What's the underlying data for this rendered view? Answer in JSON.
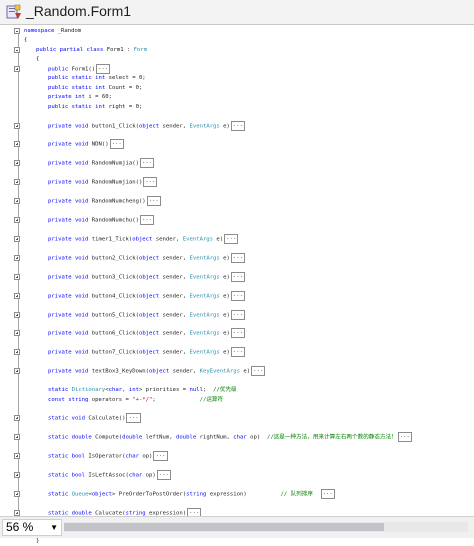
{
  "window": {
    "title": "_Random.Form1",
    "icon": "csharp-file-icon"
  },
  "code_lines": [
    {
      "indent": 0,
      "fold": "minus",
      "parts": [
        {
          "k": "kw",
          "t": "namespace"
        },
        {
          "k": "n",
          "t": " _Random"
        }
      ]
    },
    {
      "indent": 0,
      "fold": "",
      "parts": [
        {
          "k": "n",
          "t": "{"
        }
      ]
    },
    {
      "indent": 1,
      "fold": "minus",
      "parts": [
        {
          "k": "kw",
          "t": "public partial class"
        },
        {
          "k": "n",
          "t": " Form1 : "
        },
        {
          "k": "ty",
          "t": "Form"
        }
      ]
    },
    {
      "indent": 1,
      "fold": "",
      "parts": [
        {
          "k": "n",
          "t": "{"
        }
      ]
    },
    {
      "indent": 2,
      "fold": "plus",
      "parts": [
        {
          "k": "kw",
          "t": "public"
        },
        {
          "k": "n",
          "t": " Form1()"
        }
      ],
      "collapsed": "..."
    },
    {
      "indent": 2,
      "fold": "",
      "parts": [
        {
          "k": "kw",
          "t": "public static int"
        },
        {
          "k": "n",
          "t": " select = 0;"
        }
      ]
    },
    {
      "indent": 2,
      "fold": "",
      "parts": [
        {
          "k": "kw",
          "t": "public static int"
        },
        {
          "k": "n",
          "t": " Count = 0;"
        }
      ]
    },
    {
      "indent": 2,
      "fold": "",
      "parts": [
        {
          "k": "kw",
          "t": "private int"
        },
        {
          "k": "n",
          "t": " i = 60;"
        }
      ]
    },
    {
      "indent": 2,
      "fold": "",
      "parts": [
        {
          "k": "kw",
          "t": "public static int"
        },
        {
          "k": "n",
          "t": " right = 0;"
        }
      ]
    },
    {
      "indent": 0,
      "fold": "",
      "parts": []
    },
    {
      "indent": 2,
      "fold": "plus",
      "parts": [
        {
          "k": "kw",
          "t": "private void"
        },
        {
          "k": "n",
          "t": " button1_Click("
        },
        {
          "k": "kw",
          "t": "object"
        },
        {
          "k": "n",
          "t": " sender, "
        },
        {
          "k": "ty",
          "t": "EventArgs"
        },
        {
          "k": "n",
          "t": " e)"
        }
      ],
      "collapsed": "..."
    },
    {
      "indent": 0,
      "fold": "",
      "parts": []
    },
    {
      "indent": 2,
      "fold": "plus",
      "parts": [
        {
          "k": "kw",
          "t": "private void"
        },
        {
          "k": "n",
          "t": " NDN()"
        }
      ],
      "collapsed": "..."
    },
    {
      "indent": 0,
      "fold": "",
      "parts": []
    },
    {
      "indent": 2,
      "fold": "plus",
      "parts": [
        {
          "k": "kw",
          "t": "private void"
        },
        {
          "k": "n",
          "t": " RandomNumjia()"
        }
      ],
      "collapsed": "..."
    },
    {
      "indent": 0,
      "fold": "",
      "parts": []
    },
    {
      "indent": 2,
      "fold": "plus",
      "parts": [
        {
          "k": "kw",
          "t": "private void"
        },
        {
          "k": "n",
          "t": " RandomNumjian()"
        }
      ],
      "collapsed": "..."
    },
    {
      "indent": 0,
      "fold": "",
      "parts": []
    },
    {
      "indent": 2,
      "fold": "plus",
      "parts": [
        {
          "k": "kw",
          "t": "private void"
        },
        {
          "k": "n",
          "t": " RandomNumcheng()"
        }
      ],
      "collapsed": "..."
    },
    {
      "indent": 0,
      "fold": "",
      "parts": []
    },
    {
      "indent": 2,
      "fold": "plus",
      "parts": [
        {
          "k": "kw",
          "t": "private void"
        },
        {
          "k": "n",
          "t": " RandomNumchu()"
        }
      ],
      "collapsed": "..."
    },
    {
      "indent": 0,
      "fold": "",
      "parts": []
    },
    {
      "indent": 2,
      "fold": "plus",
      "parts": [
        {
          "k": "kw",
          "t": "private void"
        },
        {
          "k": "n",
          "t": " timer1_Tick("
        },
        {
          "k": "kw",
          "t": "object"
        },
        {
          "k": "n",
          "t": " sender, "
        },
        {
          "k": "ty",
          "t": "EventArgs"
        },
        {
          "k": "n",
          "t": " e)"
        }
      ],
      "collapsed": "..."
    },
    {
      "indent": 0,
      "fold": "",
      "parts": []
    },
    {
      "indent": 2,
      "fold": "plus",
      "parts": [
        {
          "k": "kw",
          "t": "private void"
        },
        {
          "k": "n",
          "t": " button2_Click("
        },
        {
          "k": "kw",
          "t": "object"
        },
        {
          "k": "n",
          "t": " sender, "
        },
        {
          "k": "ty",
          "t": "EventArgs"
        },
        {
          "k": "n",
          "t": " e)"
        }
      ],
      "collapsed": "..."
    },
    {
      "indent": 0,
      "fold": "",
      "parts": []
    },
    {
      "indent": 2,
      "fold": "plus",
      "parts": [
        {
          "k": "kw",
          "t": "private void"
        },
        {
          "k": "n",
          "t": " button3_Click("
        },
        {
          "k": "kw",
          "t": "object"
        },
        {
          "k": "n",
          "t": " sender, "
        },
        {
          "k": "ty",
          "t": "EventArgs"
        },
        {
          "k": "n",
          "t": " e)"
        }
      ],
      "collapsed": "..."
    },
    {
      "indent": 0,
      "fold": "",
      "parts": []
    },
    {
      "indent": 2,
      "fold": "plus",
      "parts": [
        {
          "k": "kw",
          "t": "private void"
        },
        {
          "k": "n",
          "t": " button4_Click("
        },
        {
          "k": "kw",
          "t": "object"
        },
        {
          "k": "n",
          "t": " sender, "
        },
        {
          "k": "ty",
          "t": "EventArgs"
        },
        {
          "k": "n",
          "t": " e)"
        }
      ],
      "collapsed": "..."
    },
    {
      "indent": 0,
      "fold": "",
      "parts": []
    },
    {
      "indent": 2,
      "fold": "plus",
      "parts": [
        {
          "k": "kw",
          "t": "private void"
        },
        {
          "k": "n",
          "t": " button5_Click("
        },
        {
          "k": "kw",
          "t": "object"
        },
        {
          "k": "n",
          "t": " sender, "
        },
        {
          "k": "ty",
          "t": "EventArgs"
        },
        {
          "k": "n",
          "t": " e)"
        }
      ],
      "collapsed": "..."
    },
    {
      "indent": 0,
      "fold": "",
      "parts": []
    },
    {
      "indent": 2,
      "fold": "plus",
      "parts": [
        {
          "k": "kw",
          "t": "private void"
        },
        {
          "k": "n",
          "t": " button6_Click("
        },
        {
          "k": "kw",
          "t": "object"
        },
        {
          "k": "n",
          "t": " sender, "
        },
        {
          "k": "ty",
          "t": "EventArgs"
        },
        {
          "k": "n",
          "t": " e)"
        }
      ],
      "collapsed": "..."
    },
    {
      "indent": 0,
      "fold": "",
      "parts": []
    },
    {
      "indent": 2,
      "fold": "plus",
      "parts": [
        {
          "k": "kw",
          "t": "private void"
        },
        {
          "k": "n",
          "t": " button7_Click("
        },
        {
          "k": "kw",
          "t": "object"
        },
        {
          "k": "n",
          "t": " sender, "
        },
        {
          "k": "ty",
          "t": "EventArgs"
        },
        {
          "k": "n",
          "t": " e)"
        }
      ],
      "collapsed": "..."
    },
    {
      "indent": 0,
      "fold": "",
      "parts": []
    },
    {
      "indent": 2,
      "fold": "plus",
      "parts": [
        {
          "k": "kw",
          "t": "private void"
        },
        {
          "k": "n",
          "t": " textBox3_KeyDown("
        },
        {
          "k": "kw",
          "t": "object"
        },
        {
          "k": "n",
          "t": " sender, "
        },
        {
          "k": "ty",
          "t": "KeyEventArgs"
        },
        {
          "k": "n",
          "t": " e)"
        }
      ],
      "collapsed": "..."
    },
    {
      "indent": 0,
      "fold": "",
      "parts": []
    },
    {
      "indent": 2,
      "fold": "",
      "parts": [
        {
          "k": "kw",
          "t": "static"
        },
        {
          "k": "n",
          "t": " "
        },
        {
          "k": "ty",
          "t": "Dictionary"
        },
        {
          "k": "n",
          "t": "<"
        },
        {
          "k": "kw",
          "t": "char"
        },
        {
          "k": "n",
          "t": ", "
        },
        {
          "k": "kw",
          "t": "int"
        },
        {
          "k": "n",
          "t": "> priorities = "
        },
        {
          "k": "kw",
          "t": "null"
        },
        {
          "k": "n",
          "t": ";  "
        },
        {
          "k": "cm",
          "t": "//优先级"
        }
      ]
    },
    {
      "indent": 2,
      "fold": "",
      "parts": [
        {
          "k": "kw",
          "t": "const string"
        },
        {
          "k": "n",
          "t": " operators = "
        },
        {
          "k": "st",
          "t": "\"+-*/\""
        },
        {
          "k": "n",
          "t": ";             "
        },
        {
          "k": "cm",
          "t": "//运算符"
        }
      ]
    },
    {
      "indent": 0,
      "fold": "",
      "parts": []
    },
    {
      "indent": 2,
      "fold": "plus",
      "parts": [
        {
          "k": "kw",
          "t": "static void"
        },
        {
          "k": "n",
          "t": " Calculate()"
        }
      ],
      "collapsed": "..."
    },
    {
      "indent": 0,
      "fold": "",
      "parts": []
    },
    {
      "indent": 2,
      "fold": "plus",
      "parts": [
        {
          "k": "kw",
          "t": "static double"
        },
        {
          "k": "n",
          "t": " Compute("
        },
        {
          "k": "kw",
          "t": "double"
        },
        {
          "k": "n",
          "t": " leftNum, "
        },
        {
          "k": "kw",
          "t": "double"
        },
        {
          "k": "n",
          "t": " rightNum, "
        },
        {
          "k": "kw",
          "t": "char"
        },
        {
          "k": "n",
          "t": " op)  "
        },
        {
          "k": "cm",
          "t": "//这是一种方法，用来计算左右两个数的静态方法！"
        }
      ],
      "collapsed": "..."
    },
    {
      "indent": 0,
      "fold": "",
      "parts": []
    },
    {
      "indent": 2,
      "fold": "plus",
      "parts": [
        {
          "k": "kw",
          "t": "static bool"
        },
        {
          "k": "n",
          "t": " IsOperator("
        },
        {
          "k": "kw",
          "t": "char"
        },
        {
          "k": "n",
          "t": " op)"
        }
      ],
      "collapsed": "..."
    },
    {
      "indent": 0,
      "fold": "",
      "parts": []
    },
    {
      "indent": 2,
      "fold": "plus",
      "parts": [
        {
          "k": "kw",
          "t": "static bool"
        },
        {
          "k": "n",
          "t": " IsLeftAssoc("
        },
        {
          "k": "kw",
          "t": "char"
        },
        {
          "k": "n",
          "t": " op)"
        }
      ],
      "collapsed": "..."
    },
    {
      "indent": 0,
      "fold": "",
      "parts": []
    },
    {
      "indent": 2,
      "fold": "plus",
      "parts": [
        {
          "k": "kw",
          "t": "static"
        },
        {
          "k": "n",
          "t": " "
        },
        {
          "k": "ty",
          "t": "Queue"
        },
        {
          "k": "n",
          "t": "<"
        },
        {
          "k": "kw",
          "t": "object"
        },
        {
          "k": "n",
          "t": "> PreOrderToPostOrder("
        },
        {
          "k": "kw",
          "t": "string"
        },
        {
          "k": "n",
          "t": " expression)          "
        },
        {
          "k": "cm",
          "t": "// 队列排序"
        },
        {
          "k": "n",
          "t": "  "
        }
      ],
      "collapsed": "..."
    },
    {
      "indent": 0,
      "fold": "",
      "parts": []
    },
    {
      "indent": 2,
      "fold": "plus",
      "parts": [
        {
          "k": "kw",
          "t": "static double"
        },
        {
          "k": "n",
          "t": " Calucate("
        },
        {
          "k": "kw",
          "t": "string"
        },
        {
          "k": "n",
          "t": " expression)"
        }
      ],
      "collapsed": "..."
    },
    {
      "indent": 0,
      "fold": "",
      "parts": []
    },
    {
      "indent": 0,
      "fold": "",
      "parts": []
    },
    {
      "indent": 1,
      "fold": "",
      "parts": [
        {
          "k": "n",
          "t": "}"
        }
      ]
    }
  ],
  "status": {
    "zoom": "56 %",
    "zoom_arrow": "▼"
  },
  "colors": {
    "keyword": "#0000ff",
    "type": "#2b91af",
    "comment": "#008000",
    "string": "#a31515"
  }
}
